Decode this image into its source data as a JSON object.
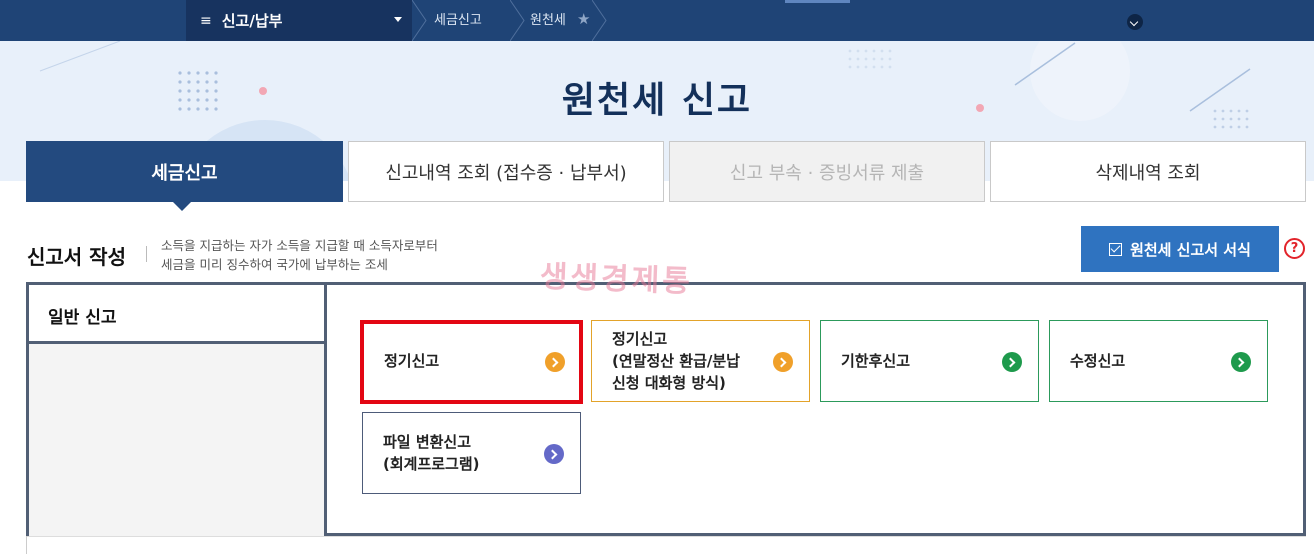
{
  "nav": {
    "menu_label": "신고/납부",
    "breadcrumbs": [
      "세금신고",
      "원천세"
    ]
  },
  "banner": {
    "title": "원천세  신고"
  },
  "tabs": [
    {
      "label": "세금신고",
      "state": "active"
    },
    {
      "label": "신고내역 조회 (접수증 · 납부서)",
      "state": "normal"
    },
    {
      "label": "신고 부속 · 증빙서류 제출",
      "state": "disabled"
    },
    {
      "label": "삭제내역 조회",
      "state": "normal"
    }
  ],
  "section": {
    "title": "신고서 작성",
    "desc_line1": "소득을 지급하는 자가 소득을 지급할 때 소득자로부터",
    "desc_line2": "세금을 미리 징수하여 국가에 납부하는 조세",
    "form_button": "원천세 신고서 서식",
    "help_glyph": "?"
  },
  "watermark": "생생경제통",
  "panel": {
    "general_tab": "일반 신고"
  },
  "cards": [
    {
      "line1": "정기신고",
      "line2": "",
      "line3": "",
      "accent": "#f0a02a",
      "highlighted": true
    },
    {
      "line1": "정기신고",
      "line2": "(연말정산 환급/분납",
      "line3": "신청 대화형 방식)",
      "accent": "#f0a02a",
      "highlighted": false
    },
    {
      "line1": "기한후신고",
      "line2": "",
      "line3": "",
      "accent": "#1e9a4c",
      "highlighted": false
    },
    {
      "line1": "수정신고",
      "line2": "",
      "line3": "",
      "accent": "#1e9a4c",
      "highlighted": false
    },
    {
      "line1": "파일 변환신고",
      "line2": "(회계프로그램)",
      "line3": "",
      "accent": "#6469c8",
      "highlighted": false
    }
  ],
  "colors": {
    "nav_bg": "#1f4476",
    "active_tab": "#234a7f",
    "form_button": "#2f73c0",
    "highlight_border": "#e30613"
  }
}
